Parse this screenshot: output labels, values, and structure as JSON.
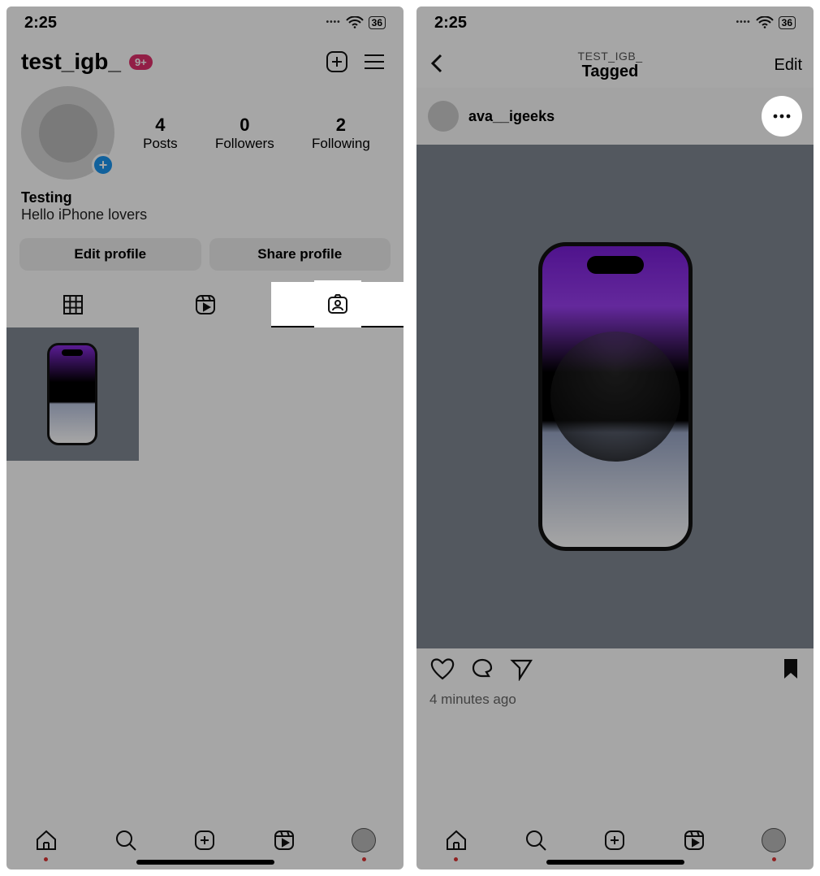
{
  "left": {
    "status": {
      "time": "2:25",
      "battery": "36"
    },
    "header": {
      "username": "test_igb_",
      "badge": "9+"
    },
    "stats": {
      "posts": {
        "num": "4",
        "label": "Posts"
      },
      "followers": {
        "num": "0",
        "label": "Followers"
      },
      "following": {
        "num": "2",
        "label": "Following"
      }
    },
    "bio": {
      "name": "Testing",
      "text": "Hello iPhone lovers"
    },
    "buttons": {
      "edit": "Edit profile",
      "share": "Share profile"
    }
  },
  "right": {
    "status": {
      "time": "2:25",
      "battery": "36"
    },
    "header": {
      "subtitle": "TEST_IGB_",
      "title": "Tagged",
      "edit": "Edit"
    },
    "post": {
      "username": "ava__igeeks",
      "timestamp": "4 minutes ago"
    }
  }
}
